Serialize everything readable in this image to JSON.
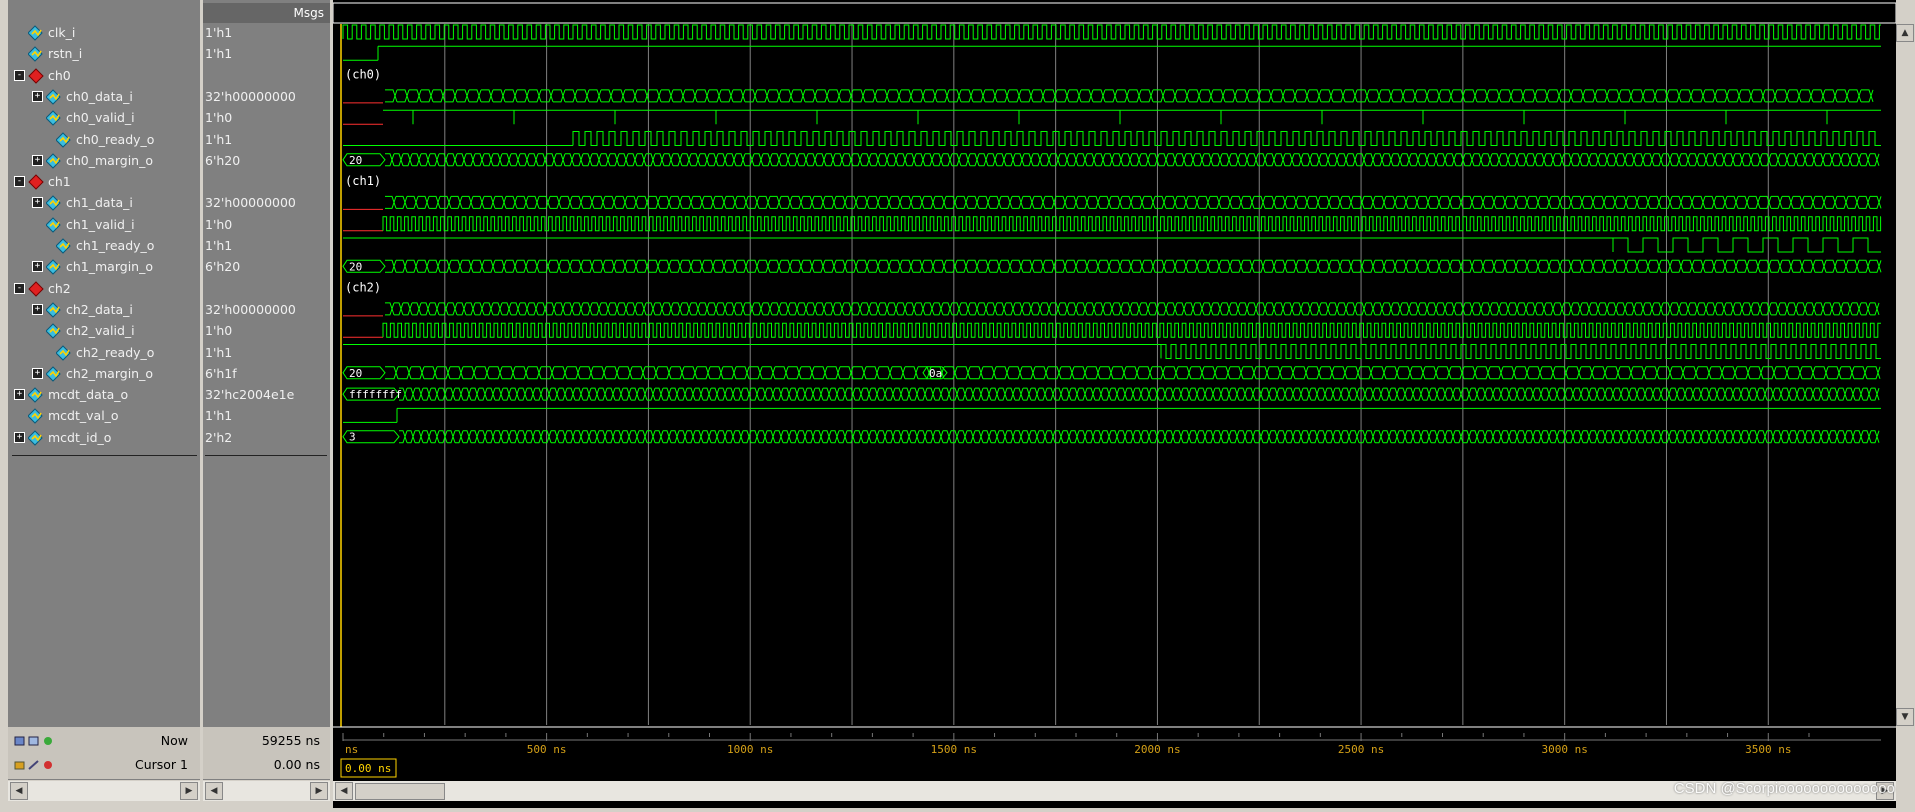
{
  "toolbar": {
    "icon": "wave-window-icon"
  },
  "header": {
    "msgs_label": "Msgs"
  },
  "signals": [
    {
      "name": "clk_i",
      "value": "1'h1",
      "indent": 1,
      "kind": "signal",
      "expander": ""
    },
    {
      "name": "rstn_i",
      "value": "1'h1",
      "indent": 1,
      "kind": "signal",
      "expander": ""
    },
    {
      "name": "ch0",
      "value": "",
      "indent": 1,
      "kind": "group",
      "expander": "-"
    },
    {
      "name": "ch0_data_i",
      "value": "32'h00000000",
      "indent": 2,
      "kind": "signal",
      "expander": "+"
    },
    {
      "name": "ch0_valid_i",
      "value": "1'h0",
      "indent": 2,
      "kind": "signal",
      "expander": ""
    },
    {
      "name": "ch0_ready_o",
      "value": "1'h1",
      "indent": 3,
      "kind": "signal",
      "expander": ""
    },
    {
      "name": "ch0_margin_o",
      "value": "6'h20",
      "indent": 2,
      "kind": "signal",
      "expander": "+"
    },
    {
      "name": "ch1",
      "value": "",
      "indent": 1,
      "kind": "group",
      "expander": "-"
    },
    {
      "name": "ch1_data_i",
      "value": "32'h00000000",
      "indent": 2,
      "kind": "signal",
      "expander": "+"
    },
    {
      "name": "ch1_valid_i",
      "value": "1'h0",
      "indent": 2,
      "kind": "signal",
      "expander": ""
    },
    {
      "name": "ch1_ready_o",
      "value": "1'h1",
      "indent": 3,
      "kind": "signal",
      "expander": ""
    },
    {
      "name": "ch1_margin_o",
      "value": "6'h20",
      "indent": 2,
      "kind": "signal",
      "expander": "+"
    },
    {
      "name": "ch2",
      "value": "",
      "indent": 1,
      "kind": "group",
      "expander": "-"
    },
    {
      "name": "ch2_data_i",
      "value": "32'h00000000",
      "indent": 2,
      "kind": "signal",
      "expander": "+"
    },
    {
      "name": "ch2_valid_i",
      "value": "1'h0",
      "indent": 2,
      "kind": "signal",
      "expander": ""
    },
    {
      "name": "ch2_ready_o",
      "value": "1'h1",
      "indent": 3,
      "kind": "signal",
      "expander": ""
    },
    {
      "name": "ch2_margin_o",
      "value": "6'h1f",
      "indent": 2,
      "kind": "signal",
      "expander": "+"
    },
    {
      "name": "mcdt_data_o",
      "value": "32'hc2004e1e",
      "indent": 1,
      "kind": "signal",
      "expander": "+"
    },
    {
      "name": "mcdt_val_o",
      "value": "1'h1",
      "indent": 1,
      "kind": "signal",
      "expander": ""
    },
    {
      "name": "mcdt_id_o",
      "value": "2'h2",
      "indent": 1,
      "kind": "signal",
      "expander": "+"
    }
  ],
  "waves": {
    "group_labels": [
      "(ch0)",
      "(ch1)",
      "(ch2)"
    ],
    "bus_initial": {
      "ch0_margin_o": "20",
      "ch1_margin_o": "20",
      "ch2_margin_o": "20",
      "ch2_margin_mid": "0a",
      "mcdt_data_o": "ffffffff",
      "mcdt_id_o": "3"
    },
    "trace_color": "#00ff00",
    "reset_color": "#ff3030",
    "grid_color": "#808080"
  },
  "timeline": {
    "ticks": [
      "ns",
      "500 ns",
      "1000 ns",
      "1500 ns",
      "2000 ns",
      "2500 ns",
      "3000 ns",
      "3500 ns"
    ]
  },
  "status": {
    "now_label": "Now",
    "now_value": "59255 ns",
    "cursor_label": "Cursor 1",
    "cursor_value": "0.00 ns",
    "cursor_marker": "0.00 ns"
  },
  "watermark": "CSDN @Scorpioooooooooooooo"
}
